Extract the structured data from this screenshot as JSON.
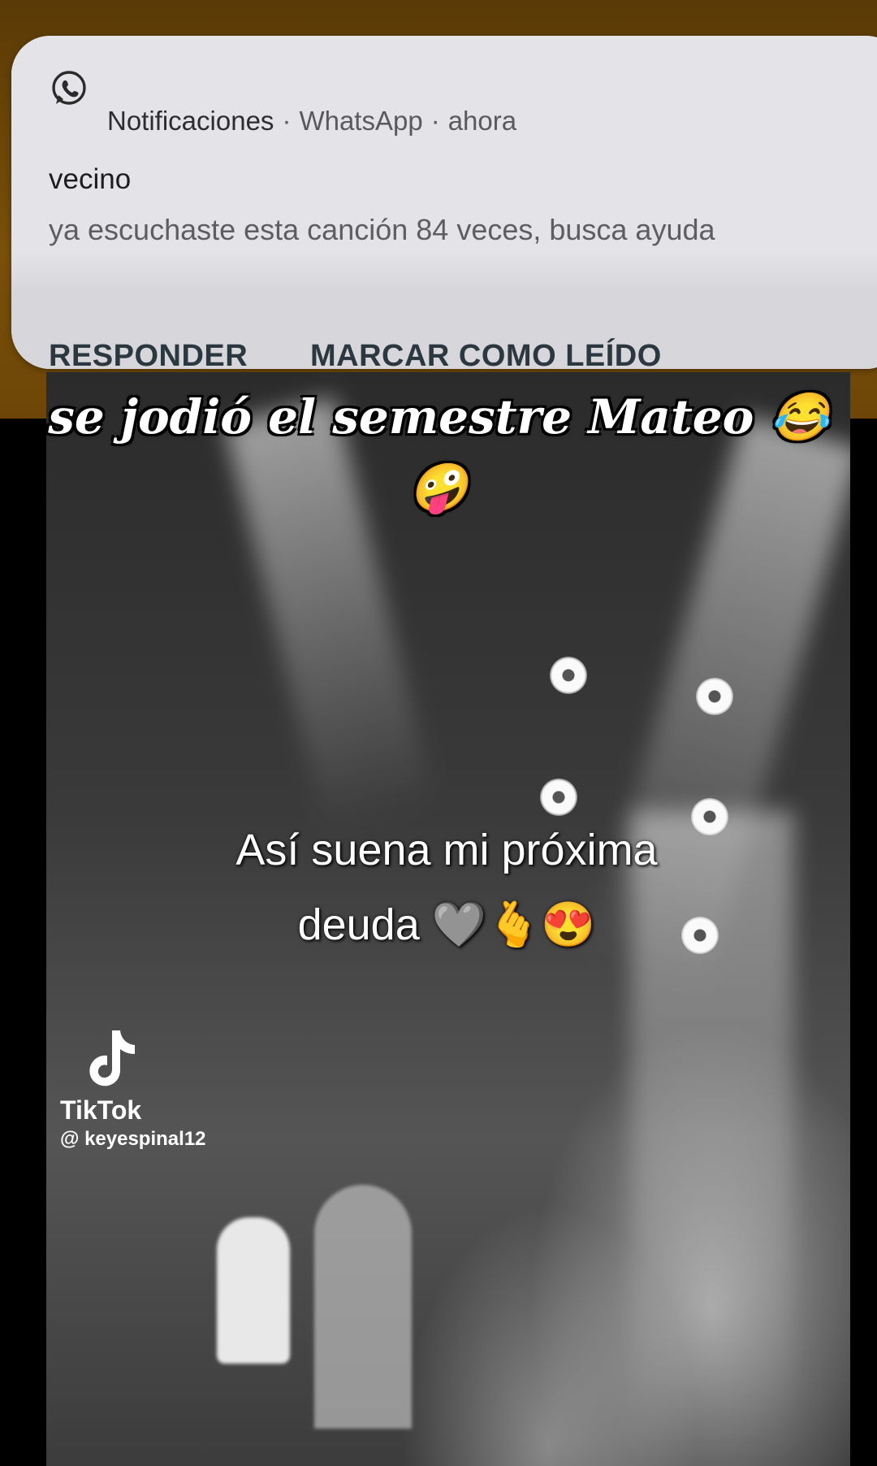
{
  "notification": {
    "icon": "whatsapp-icon",
    "source_label": "Notificaciones",
    "app_name": "WhatsApp",
    "time": "ahora",
    "separator": "·",
    "sender": "vecino",
    "message": "ya escuchaste esta canción 84 veces, busca ayuda",
    "actions": {
      "reply": "RESPONDER",
      "mark_read": "MARCAR COMO LEÍDO"
    }
  },
  "caption": {
    "line1": "se jodió el semestre Mateo 😂",
    "line2": "🤪"
  },
  "video_overlay": {
    "line1": "Así suena mi próxima",
    "line2": "deuda 🩶🫰😍"
  },
  "watermark": {
    "brand": "TikTok",
    "user": "@ keyespinal12"
  },
  "colors": {
    "whatsapp": "#25D366",
    "strip_brown": "#6d4607",
    "notification_bg": "#e4e4e8"
  }
}
